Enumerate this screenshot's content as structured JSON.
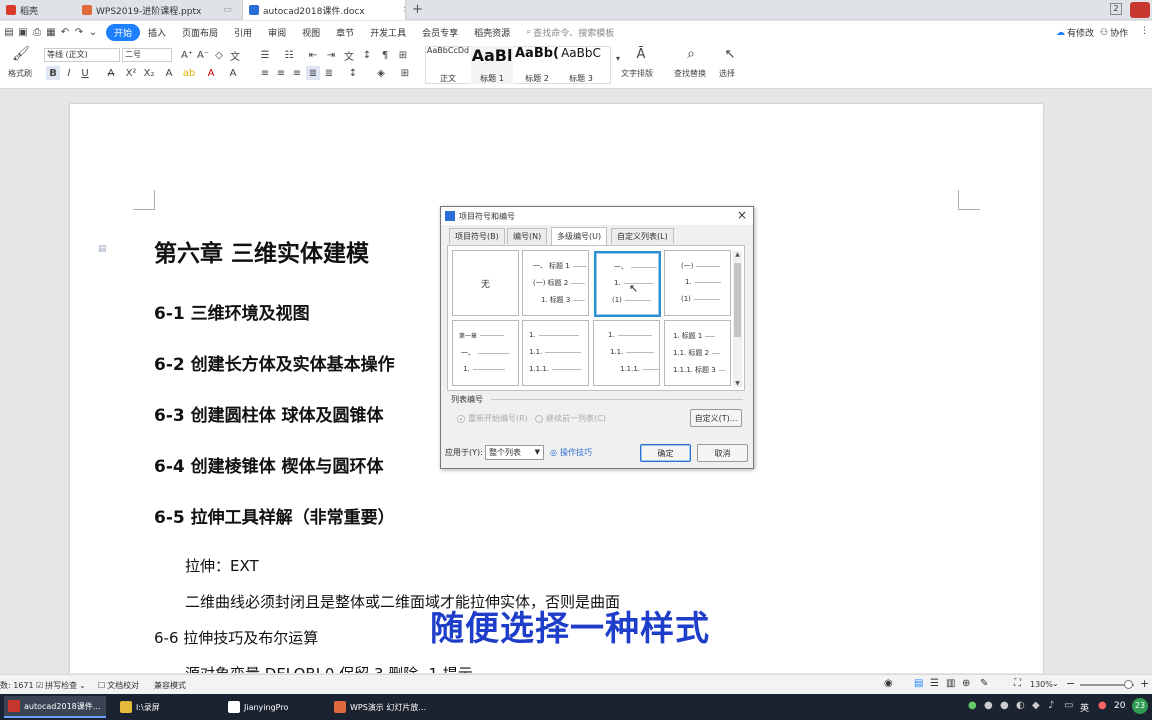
{
  "window_tabs": [
    {
      "label": "稻壳",
      "icon_color": "#d93a2b"
    },
    {
      "label": "WPS2019-进阶课程.pptx",
      "icon_color": "#e06a3b"
    },
    {
      "label": "autocad2018课件.docx",
      "icon_color": "#2b6fd6"
    }
  ],
  "window_badge": "2",
  "ribbon_tabs": [
    "开始",
    "插入",
    "页面布局",
    "引用",
    "审阅",
    "视图",
    "章节",
    "开发工具",
    "会员专享",
    "稻壳资源"
  ],
  "search": {
    "placeholder": "查找命令、搜索模板"
  },
  "right_actions": {
    "modified": "有修改",
    "collab": "协作"
  },
  "toolbar": {
    "format_painter": "格式刷",
    "font_name": "等线 (正文)",
    "font_size": "二号",
    "styles": [
      {
        "preview": "AaBbCcDd",
        "label": "正文"
      },
      {
        "preview": "AaBl",
        "label": "标题 1"
      },
      {
        "preview": "AaBb(",
        "label": "标题 2"
      },
      {
        "preview": "AaBbC",
        "label": "标题 3"
      }
    ],
    "text_layout": "文字排版",
    "find_replace": "查找替换",
    "select": "选择"
  },
  "document": {
    "chapter_title": "第六章  三维实体建模",
    "sections": [
      "6-1  三维环境及视图",
      "6-2  创建长方体及实体基本操作",
      "6-3  创建圆柱体  球体及圆锥体",
      "6-4  创建棱锥体  楔体与圆环体",
      "6-5  拉伸工具祥解（非常重要）"
    ],
    "para1": "拉伸：EXT",
    "para2": "二维曲线必须封闭且是整体或二维面域才能拉伸实体，否则是曲面",
    "section66": "6-6  拉伸技巧及布尔运算",
    "para3": "源对象变量  DELOBJ        0  保留     3  删除    -1  提示"
  },
  "caption": "随便选择一种样式",
  "dialog": {
    "title": "项目符号和编号",
    "tabs": [
      "项目符号(B)",
      "编号(N)",
      "多级编号(U)",
      "自定义列表(L)"
    ],
    "none_label": "无",
    "cells": {
      "c2": [
        "一、",
        "标题 1",
        "(一)",
        "标题 2",
        "1.",
        "标题 3"
      ],
      "c3": [
        "一、",
        "1.",
        "(1)"
      ],
      "c4": [
        "(一)",
        "1.",
        "(1)"
      ],
      "c5": [
        "第一章",
        "一、",
        "1."
      ],
      "c6": [
        "1.",
        "1.1.",
        "1.1.1."
      ],
      "c7": [
        "1.",
        "1.1.",
        "1.1.1."
      ],
      "c8": [
        "1.",
        "标题 1",
        "1.1.",
        "标题 2",
        "1.1.1.",
        "标题 3"
      ]
    },
    "list_numbering_label": "列表编号",
    "radio_restart": "重新开始编号(R)",
    "radio_continue": "继续前一列表(C)",
    "customize": "自定义(T)...",
    "apply_to_label": "应用于(Y):",
    "apply_to_value": "整个列表",
    "tips": "操作技巧",
    "ok": "确定",
    "cancel": "取消"
  },
  "status": {
    "word_count": "数: 1671",
    "spell": "拼写检查",
    "doc_check": "文档校对",
    "compat": "兼容模式",
    "zoom": "130%"
  },
  "taskbar": [
    {
      "label": "autocad2018课件...",
      "icon_color": "#c8372d"
    },
    {
      "label": "I:\\录屏",
      "icon_color": "#e5b93a"
    },
    {
      "label": "JianyingPro",
      "icon_color": "#ffffff"
    },
    {
      "label": "WPS演示 幻灯片放...",
      "icon_color": "#e06a3b"
    }
  ],
  "tray": {
    "lang": "英",
    "time": "20",
    "badge": "23"
  }
}
